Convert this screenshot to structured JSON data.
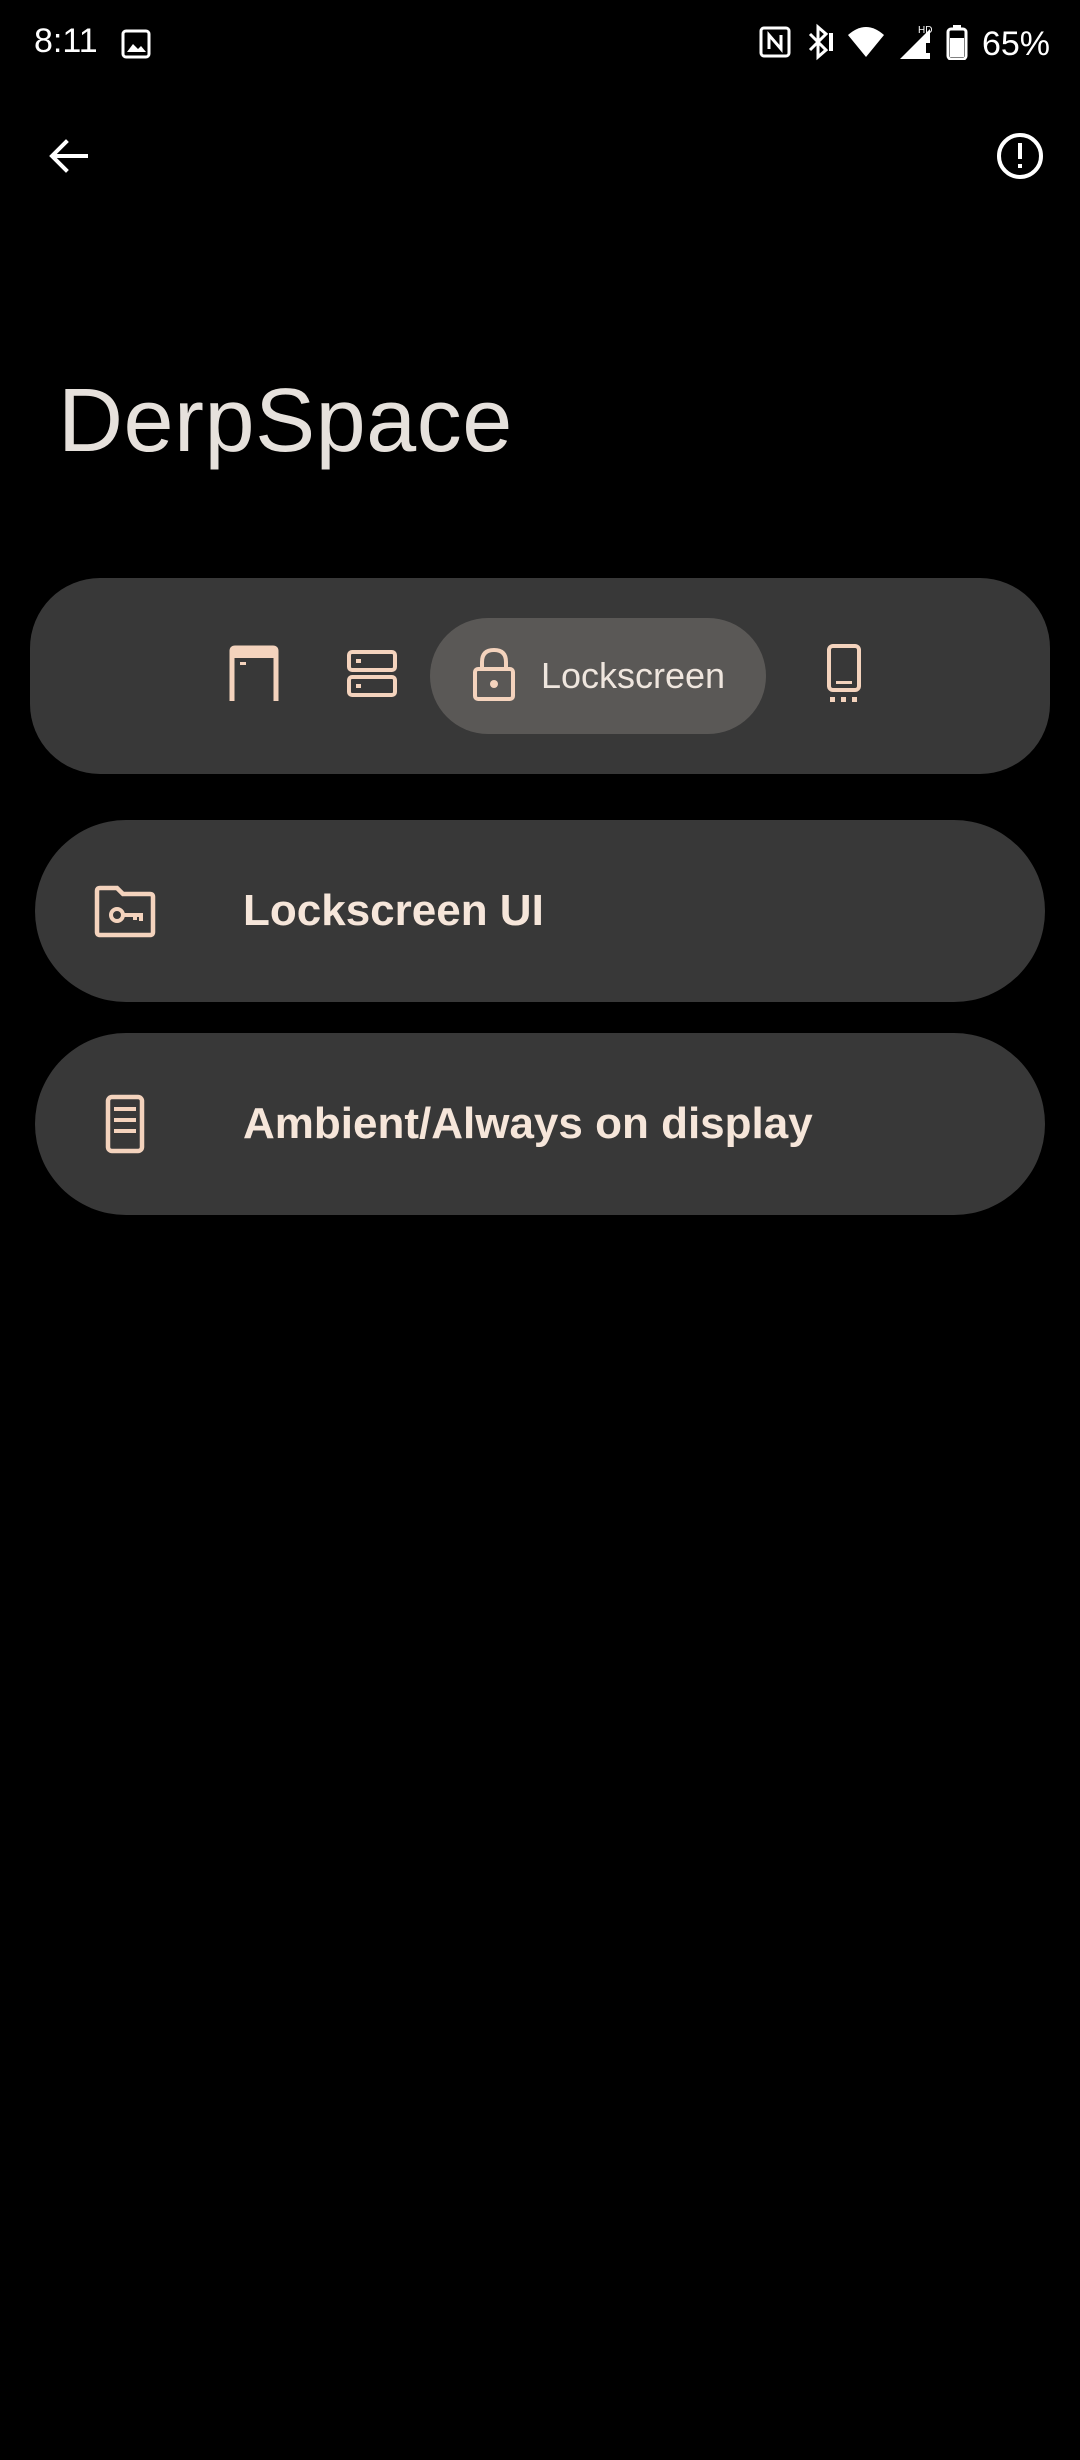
{
  "status_bar": {
    "time": "8:11",
    "battery_percent": "65%",
    "icons": [
      "image-icon",
      "nfc-icon",
      "bluetooth-icon",
      "wifi-icon",
      "signal-hd-icon",
      "battery-icon"
    ]
  },
  "header": {
    "title": "DerpSpace",
    "back_icon": "arrow-left-icon",
    "info_icon": "info-alert-icon"
  },
  "tabs": [
    {
      "icon": "statusbar-icon",
      "label": "",
      "selected": false
    },
    {
      "icon": "quick-settings-icon",
      "label": "",
      "selected": false
    },
    {
      "icon": "lock-icon",
      "label": "Lockscreen",
      "selected": true
    },
    {
      "icon": "phone-navigation-icon",
      "label": "",
      "selected": false
    }
  ],
  "items": [
    {
      "icon": "folder-key-icon",
      "label": "Lockscreen UI"
    },
    {
      "icon": "ambient-display-icon",
      "label": "Ambient/Always on display"
    }
  ],
  "colors": {
    "background": "#000000",
    "surface": "#383838",
    "selected_tab": "#5a5856",
    "accent": "#f4d3bd",
    "title_text": "#e6e1dc"
  }
}
